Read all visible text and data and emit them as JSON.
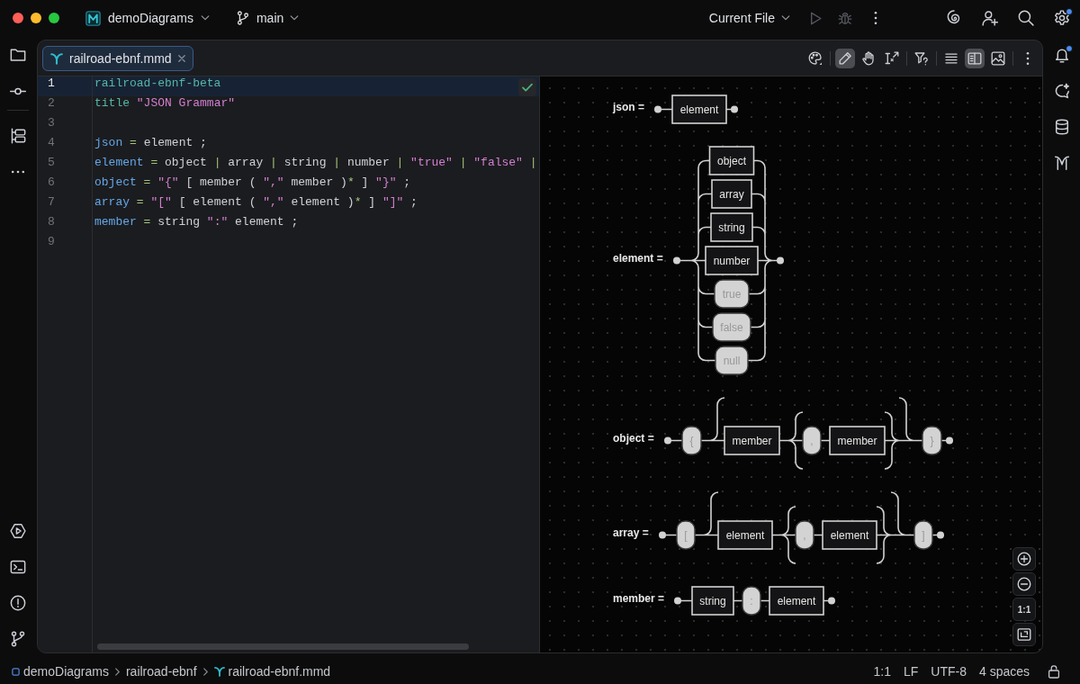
{
  "title_bar": {
    "project": "demoDiagrams",
    "branch": "main",
    "run_configuration": "Current File",
    "run_disabled": true,
    "settings_badge": true
  },
  "tabs": [
    {
      "label": "railroad-ebnf.mmd",
      "selected": true
    }
  ],
  "editor_toolbar": {
    "mode_buttons": [
      {
        "selected": true
      },
      {
        "selected": false
      },
      {
        "selected": false
      }
    ],
    "view_buttons": [
      {
        "selected": false
      },
      {
        "selected": true
      },
      {
        "selected": false
      }
    ]
  },
  "editor": {
    "lines": [
      {
        "number": "1",
        "selected": true,
        "tokens": [
          {
            "text": "railroad-ebnf-beta",
            "kind": "keyword"
          }
        ]
      },
      {
        "number": "2",
        "selected": false,
        "tokens": [
          {
            "text": "title ",
            "kind": "keyword"
          },
          {
            "text": "\"JSON Grammar\"",
            "kind": "string"
          }
        ]
      },
      {
        "number": "3",
        "selected": false
      },
      {
        "number": "4",
        "selected": false,
        "tokens": [
          {
            "text": "json",
            "kind": "rule"
          },
          {
            "text": " = ",
            "kind": "operator"
          },
          {
            "text": "element ;",
            "kind": "plain"
          }
        ]
      },
      {
        "number": "5",
        "selected": false,
        "tokens": [
          {
            "text": "element",
            "kind": "rule"
          },
          {
            "text": " = ",
            "kind": "operator"
          },
          {
            "text": "object ",
            "kind": "plain"
          },
          {
            "text": "| ",
            "kind": "operator"
          },
          {
            "text": "array ",
            "kind": "plain"
          },
          {
            "text": "| ",
            "kind": "operator"
          },
          {
            "text": "string ",
            "kind": "plain"
          },
          {
            "text": "| ",
            "kind": "operator"
          },
          {
            "text": "number ",
            "kind": "plain"
          },
          {
            "text": "| ",
            "kind": "operator"
          },
          {
            "text": "\"true\"",
            "kind": "string"
          },
          {
            "text": " | ",
            "kind": "operator"
          },
          {
            "text": "\"false\"",
            "kind": "string"
          },
          {
            "text": " |",
            "kind": "operator"
          }
        ]
      },
      {
        "number": "6",
        "selected": false,
        "tokens": [
          {
            "text": "object",
            "kind": "rule"
          },
          {
            "text": " = ",
            "kind": "operator"
          },
          {
            "text": "\"{\"",
            "kind": "string"
          },
          {
            "text": " [ member ( ",
            "kind": "plain"
          },
          {
            "text": "\",\"",
            "kind": "string"
          },
          {
            "text": " member )",
            "kind": "plain"
          },
          {
            "text": "*",
            "kind": "operator"
          },
          {
            "text": " ] ",
            "kind": "plain"
          },
          {
            "text": "\"}\"",
            "kind": "string"
          },
          {
            "text": " ;",
            "kind": "plain"
          }
        ]
      },
      {
        "number": "7",
        "selected": false,
        "tokens": [
          {
            "text": "array",
            "kind": "rule"
          },
          {
            "text": " = ",
            "kind": "operator"
          },
          {
            "text": "\"[\"",
            "kind": "string"
          },
          {
            "text": " [ element ( ",
            "kind": "plain"
          },
          {
            "text": "\",\"",
            "kind": "string"
          },
          {
            "text": " element )",
            "kind": "plain"
          },
          {
            "text": "*",
            "kind": "operator"
          },
          {
            "text": " ] ",
            "kind": "plain"
          },
          {
            "text": "\"]\"",
            "kind": "string"
          },
          {
            "text": " ;",
            "kind": "plain"
          }
        ]
      },
      {
        "number": "8",
        "selected": false,
        "tokens": [
          {
            "text": "member",
            "kind": "rule"
          },
          {
            "text": " = ",
            "kind": "operator"
          },
          {
            "text": "string ",
            "kind": "plain"
          },
          {
            "text": "\":\"",
            "kind": "string"
          },
          {
            "text": " element ;",
            "kind": "plain"
          }
        ]
      },
      {
        "number": "9",
        "selected": false
      }
    ]
  },
  "preview": {
    "rules": [
      {
        "name": "json =",
        "items": [
          {
            "kind": "nonterminal",
            "text": "element"
          }
        ]
      },
      {
        "name": "element =",
        "items": [
          {
            "kind": "choice",
            "options": [
              {
                "kind": "nonterminal",
                "text": "object"
              },
              {
                "kind": "nonterminal",
                "text": "array"
              },
              {
                "kind": "nonterminal",
                "text": "string"
              },
              {
                "kind": "nonterminal",
                "text": "number"
              },
              {
                "kind": "terminal",
                "text": "true"
              },
              {
                "kind": "terminal",
                "text": "false"
              },
              {
                "kind": "terminal",
                "text": "null"
              }
            ]
          }
        ]
      },
      {
        "name": "object =",
        "items": [
          {
            "kind": "terminal",
            "text": "{"
          },
          {
            "kind": "optional",
            "items": [
              {
                "kind": "nonterminal",
                "text": "member"
              },
              {
                "kind": "repeat",
                "items": [
                  {
                    "kind": "terminal",
                    "text": ","
                  },
                  {
                    "kind": "nonterminal",
                    "text": "member"
                  }
                ]
              }
            ]
          },
          {
            "kind": "terminal",
            "text": "}"
          }
        ]
      },
      {
        "name": "array =",
        "items": [
          {
            "kind": "terminal",
            "text": "["
          },
          {
            "kind": "optional",
            "items": [
              {
                "kind": "nonterminal",
                "text": "element"
              },
              {
                "kind": "repeat",
                "items": [
                  {
                    "kind": "terminal",
                    "text": ","
                  },
                  {
                    "kind": "nonterminal",
                    "text": "element"
                  }
                ]
              }
            ]
          },
          {
            "kind": "terminal",
            "text": "]"
          }
        ]
      },
      {
        "name": "member =",
        "items": [
          {
            "kind": "nonterminal",
            "text": "string"
          },
          {
            "kind": "terminal",
            "text": ":"
          },
          {
            "kind": "nonterminal",
            "text": "element"
          }
        ]
      }
    ],
    "zoom_controls": {
      "reset_label": "1:1"
    }
  },
  "right_toolbar": {
    "notifications_badge": true
  },
  "status_bar": {
    "breadcrumbs": [
      "demoDiagrams",
      "railroad-ebnf",
      "railroad-ebnf.mmd"
    ],
    "items": [
      "1:1",
      "LF",
      "UTF-8",
      "4 spaces"
    ]
  }
}
